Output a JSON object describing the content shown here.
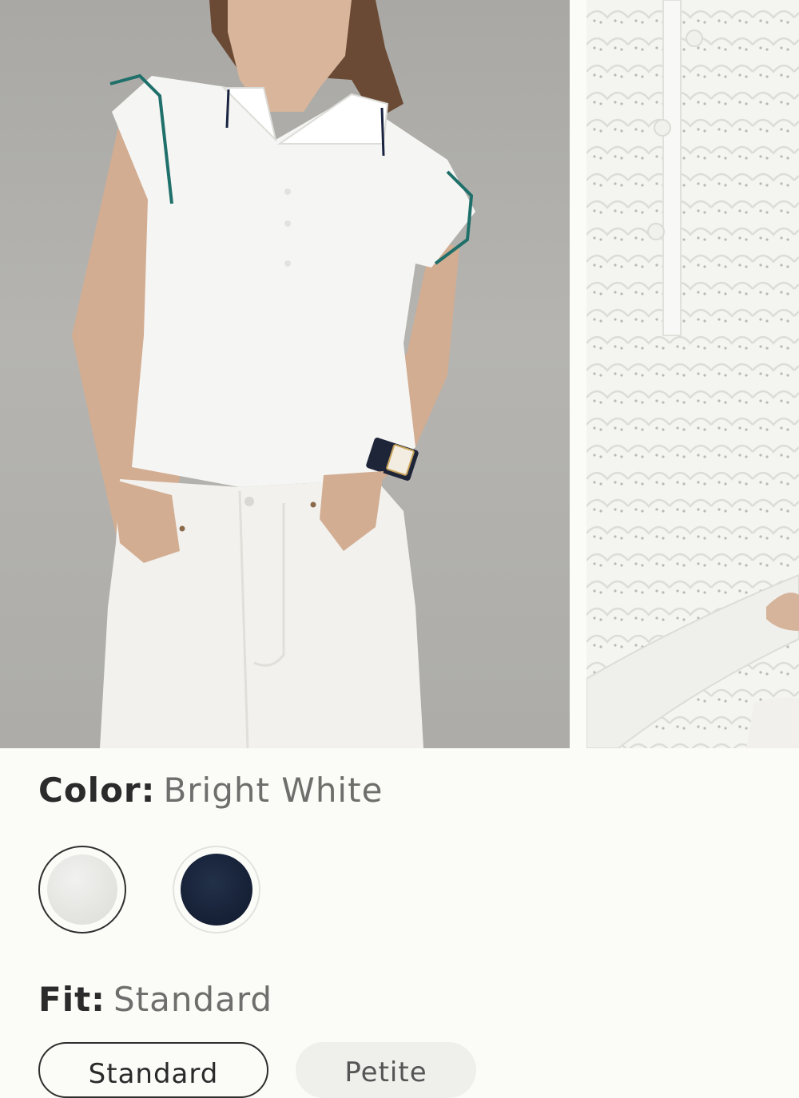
{
  "gallery": {
    "images": [
      {
        "alt": "model-photo"
      },
      {
        "alt": "fabric-detail-photo"
      }
    ]
  },
  "color": {
    "label": "Color:",
    "selected": "Bright White",
    "swatches": [
      {
        "name": "Bright White",
        "hex": "#e6e6e3",
        "selected": true
      },
      {
        "name": "Navy",
        "hex": "#18233a",
        "selected": false
      }
    ]
  },
  "fit": {
    "label": "Fit:",
    "selected": "Standard",
    "options": [
      {
        "label": "Standard",
        "selected": true
      },
      {
        "label": "Petite",
        "selected": false
      }
    ]
  },
  "colors": {
    "background": "#fbfbf8",
    "text_primary": "#2b2b2b",
    "text_secondary": "#6e6e6c"
  }
}
